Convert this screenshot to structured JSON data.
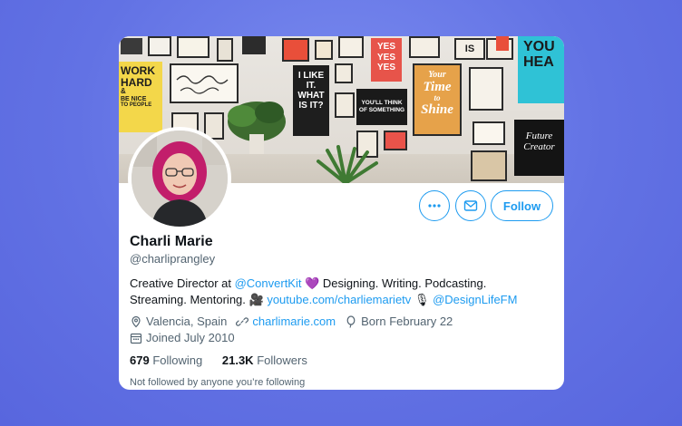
{
  "profile": {
    "name": "Charli Marie",
    "handle": "@charliprangley",
    "bio": {
      "line1_prefix": "Creative Director at ",
      "line1_mention": "@ConvertKit",
      "line1_heart": "💜",
      "line1_suffix": " Designing. Writing. Podcasting.",
      "line2_prefix": "Streaming. Mentoring. ",
      "line2_camera": "🎥",
      "line2_url": "youtube.com/charliemarietv",
      "line2_mic": "🎙",
      "line2_mention": "@DesignLifeFM"
    },
    "location": "Valencia, Spain",
    "website": "charlimarie.com",
    "birthday": "Born February 22",
    "joined": "Joined July 2010",
    "following_count": "679",
    "following_label": "Following",
    "followers_count": "21.3K",
    "followers_label": "Followers",
    "not_followed": "Not followed by anyone you’re following"
  },
  "actions": {
    "more_icon": "more-horizontal-icon",
    "message_icon": "mail-icon",
    "follow_label": "Follow"
  },
  "banner": {
    "posters": [
      {
        "l1": "WORK",
        "l2": "HARD",
        "l3": "&",
        "l4": "BE NICE",
        "l5": "TO PEOPLE"
      },
      {
        "l1": "I LIKE",
        "l2": "IT.",
        "l3": "WHAT",
        "l4": "IS IT?"
      },
      {
        "l1": "YES",
        "l2": "YES",
        "l3": "YES"
      },
      {
        "l1": "YOU'LL THINK",
        "l2": "OF SOMETHING"
      },
      {
        "l1": "Your",
        "l2": "Time",
        "l3": "to",
        "l4": "Shine"
      },
      {
        "l1": "IS"
      },
      {
        "l1": "YOU",
        "l2": "HEA"
      },
      {
        "l1": "Future",
        "l2": "Creator"
      }
    ]
  },
  "colors": {
    "accent": "#1d9bf0",
    "text": "#0f1419",
    "muted": "#536471",
    "background": "#6272e4"
  }
}
